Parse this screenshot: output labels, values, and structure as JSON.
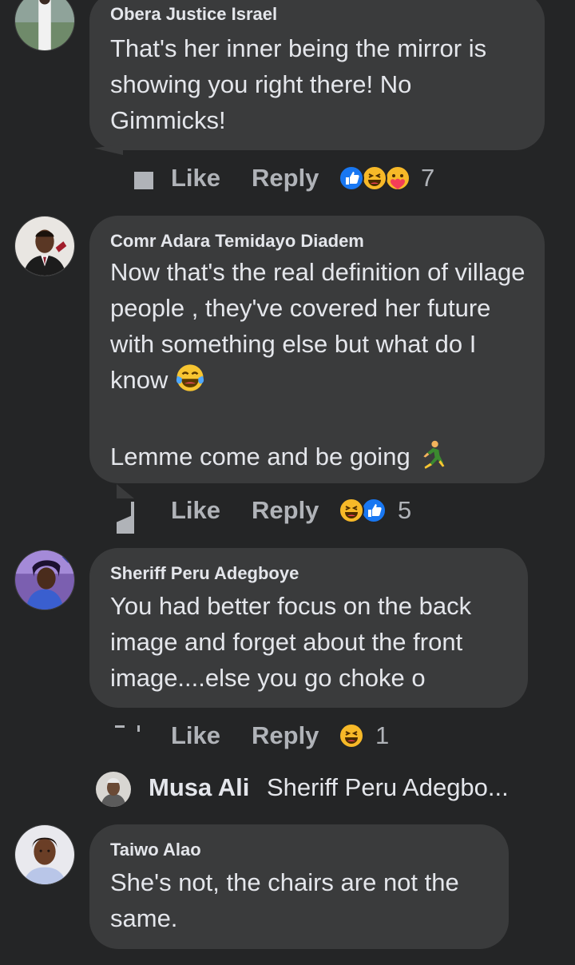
{
  "colors": {
    "background": "#242526",
    "bubble": "#3a3b3c",
    "primary_text": "#e4e6eb",
    "secondary_text": "#b0b3b8",
    "like_blue": "#1877f2",
    "haha_yellow": "#f7b928",
    "love_red": "#f33e58"
  },
  "comments": [
    {
      "author": "Obera Justice Israel",
      "text": "That's her inner being the mirror is showing you right there! No Gimmicks!",
      "like_label": "Like",
      "reply_label": "Reply",
      "reactions": [
        "like-icon",
        "haha-icon",
        "care-icon"
      ],
      "reaction_count": "7"
    },
    {
      "author": "Comr Adara Temidayo Diadem",
      "text_line1": "Now that's the real definition of village people , they've covered her future with something else but what do I know",
      "emoji1": "tears-of-joy-emoji",
      "text_line2": "Lemme come and be going",
      "emoji2": "running-man-emoji",
      "like_label": "Like",
      "reply_label": "Reply",
      "reactions": [
        "haha-icon",
        "like-icon"
      ],
      "reaction_count": "5"
    },
    {
      "author": "Sheriff Peru Adegboye",
      "text": "You had better focus on the back image and forget about the front image....else you go choke o",
      "like_label": "Like",
      "reply_label": "Reply",
      "reactions": [
        "haha-icon"
      ],
      "reaction_count": "1",
      "reply_preview": {
        "author": "Musa Ali",
        "snippet": "Sheriff Peru Adegbo..."
      }
    },
    {
      "author": "Taiwo Alao",
      "text": "She's not, the chairs are not the same."
    }
  ]
}
